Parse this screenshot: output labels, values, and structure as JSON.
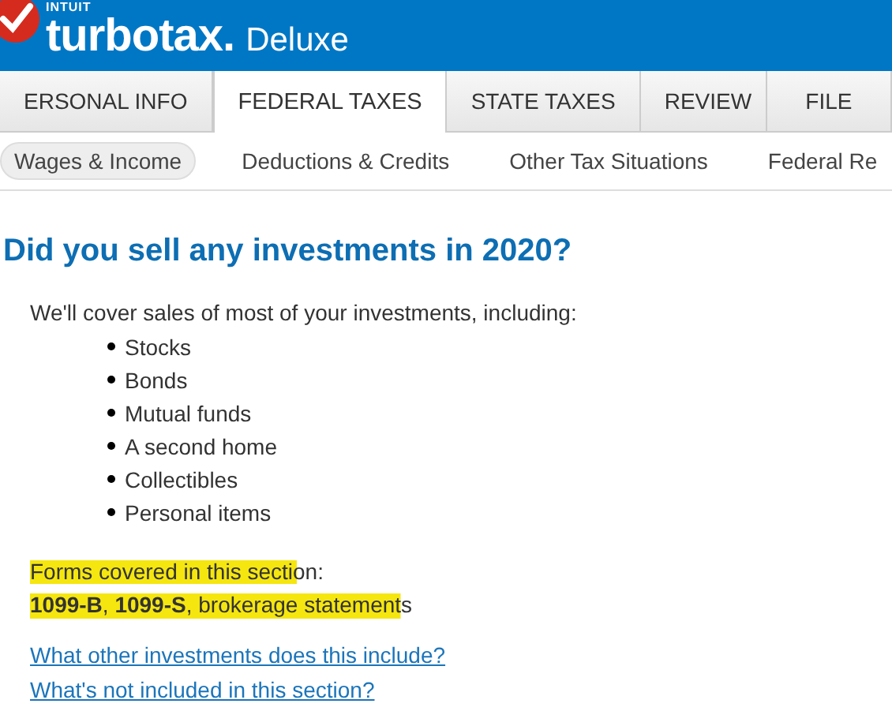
{
  "header": {
    "company": "INTUIT",
    "brand": "turbotax.",
    "edition": "Deluxe"
  },
  "tabs": [
    {
      "label": "ERSONAL INFO",
      "selected": false
    },
    {
      "label": "FEDERAL TAXES",
      "selected": true
    },
    {
      "label": "STATE TAXES",
      "selected": false
    },
    {
      "label": "REVIEW",
      "selected": false
    },
    {
      "label": "FILE",
      "selected": false
    }
  ],
  "subnav": [
    {
      "label": "Wages & Income",
      "selected": true
    },
    {
      "label": "Deductions & Credits",
      "selected": false
    },
    {
      "label": "Other Tax Situations",
      "selected": false
    },
    {
      "label": "Federal Re",
      "selected": false
    }
  ],
  "question": "Did you sell any investments in 2020?",
  "intro": "We'll cover sales of most of your investments, including:",
  "investments": [
    "Stocks",
    "Bonds",
    "Mutual funds",
    "A second home",
    "Collectibles",
    "Personal items"
  ],
  "forms": {
    "label": "Forms covered in this section:",
    "list": "**1099-B**, **1099-S**, brokerage statements",
    "highlighted": true
  },
  "links": [
    "What other investments does this include?",
    "What's not included in this section?"
  ]
}
